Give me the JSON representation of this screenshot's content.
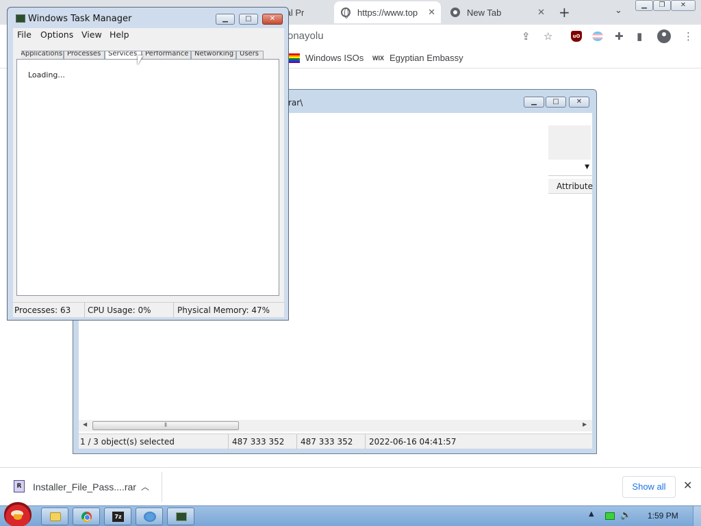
{
  "chrome": {
    "tabs": [
      {
        "label": "tal Pr"
      },
      {
        "label": "https://www.top"
      },
      {
        "label": "New Tab"
      }
    ],
    "new_tab_symbol": "+",
    "omnibox_text": "onayolu",
    "bookmarks": [
      {
        "label": "Windows ISOs",
        "icon": "rainbow-flag-icon"
      },
      {
        "label": "Egyptian Embassy",
        "icon": "wix-icon"
      }
    ]
  },
  "zip_window": {
    "path_fragment": "rar\\",
    "attributes_header": "Attribute",
    "status": {
      "selection": "1 / 3 object(s) selected",
      "size": "487 333 352",
      "packed": "487 333 352",
      "modified": "2022-06-16 04:41:57"
    }
  },
  "task_manager": {
    "title": "Windows Task Manager",
    "menu": [
      "File",
      "Options",
      "View",
      "Help"
    ],
    "tabs": [
      "Applications",
      "Processes",
      "Services",
      "Performance",
      "Networking",
      "Users"
    ],
    "active_tab": "Services",
    "loading_text": "Loading...",
    "status": {
      "processes": "Processes: 63",
      "cpu": "CPU Usage: 0%",
      "memory": "Physical Memory: 47%"
    }
  },
  "download_bar": {
    "file_name": "Installer_File_Pass....rar",
    "show_all": "Show all"
  },
  "taskbar": {
    "clock": "1:59 PM"
  },
  "colors": {
    "chrome_tabstrip": "#dee1e6",
    "taskbar": "#7aa6d6",
    "link_blue": "#1a73e8"
  }
}
